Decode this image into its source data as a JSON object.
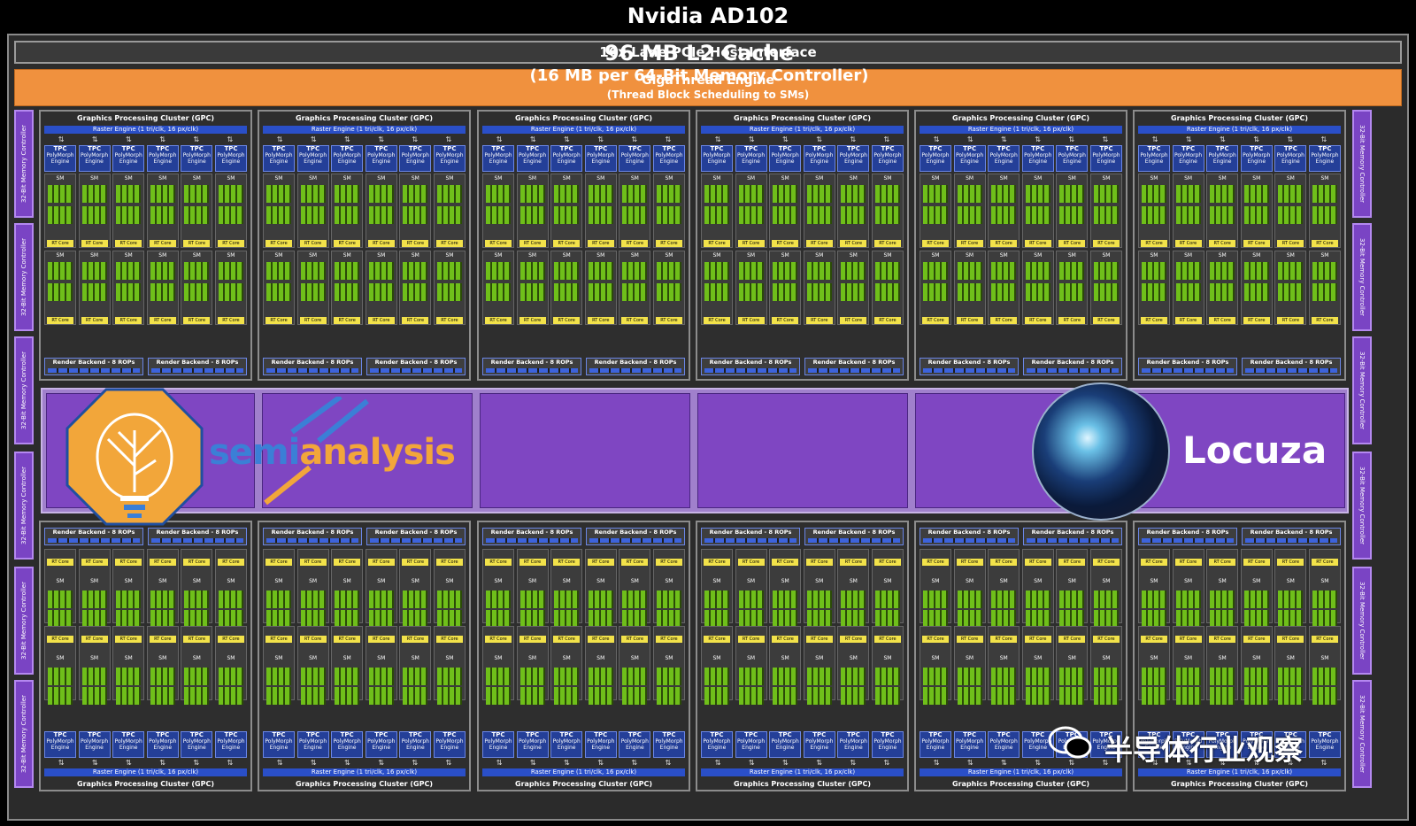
{
  "title": "Nvidia AD102",
  "pcie": "16x Lane PCIe Host Interface",
  "gigathread": {
    "line1": "GigaThread Engine",
    "line2": "(Thread Block Scheduling to SMs)"
  },
  "memory_controller_label": "32-Bit Memory Controller",
  "gpc": {
    "title": "Graphics Processing Cluster (GPC)",
    "raster": "Raster Engine (1 tri/clk, 16 px/clk)",
    "tpc": "TPC",
    "polymorph": "PolyMorph Engine",
    "sm": "SM",
    "rt_core": "RT Core",
    "render_backend": "Render Backend - 8 ROPs"
  },
  "l2": {
    "line1": "96 MB L2 Cache",
    "line2": "(16 MB per 64-Bit Memory Controller)"
  },
  "logos": {
    "semi_a": "semi",
    "semi_b": "analysis",
    "locuza": "Locuza"
  },
  "watermark": "半导体行业观察",
  "colors": {
    "gigathread": "#f0913e",
    "memctrl": "#7a44c4",
    "l2": "#7f46c2",
    "raster": "#2a4fc8",
    "rt_core": "#f2e24a",
    "cuda": "#6fbf1a"
  }
}
